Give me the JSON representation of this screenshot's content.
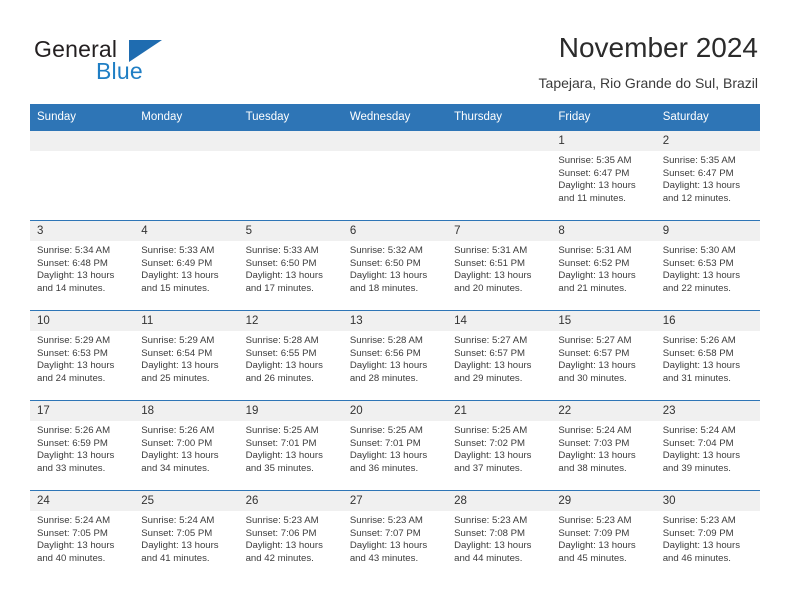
{
  "logo": {
    "word_one": "General",
    "word_two": "Blue",
    "triangle_color": "#1f6cb0",
    "blue_text_color": "#1f7ec4"
  },
  "header": {
    "title": "November 2024",
    "subtitle": "Tapejara, Rio Grande do Sul, Brazil"
  },
  "theme": {
    "header_blue": "#2e75b6",
    "daynum_gray": "#f0f0f0",
    "text": "#333333"
  },
  "calendar": {
    "weekday_headers": [
      "Sunday",
      "Monday",
      "Tuesday",
      "Wednesday",
      "Thursday",
      "Friday",
      "Saturday"
    ],
    "weeks": [
      [
        {
          "day": "",
          "empty": true
        },
        {
          "day": "",
          "empty": true
        },
        {
          "day": "",
          "empty": true
        },
        {
          "day": "",
          "empty": true
        },
        {
          "day": "",
          "empty": true
        },
        {
          "day": "1",
          "sunrise": "Sunrise: 5:35 AM",
          "sunset": "Sunset: 6:47 PM",
          "daylight": "Daylight: 13 hours and 11 minutes."
        },
        {
          "day": "2",
          "sunrise": "Sunrise: 5:35 AM",
          "sunset": "Sunset: 6:47 PM",
          "daylight": "Daylight: 13 hours and 12 minutes."
        }
      ],
      [
        {
          "day": "3",
          "sunrise": "Sunrise: 5:34 AM",
          "sunset": "Sunset: 6:48 PM",
          "daylight": "Daylight: 13 hours and 14 minutes."
        },
        {
          "day": "4",
          "sunrise": "Sunrise: 5:33 AM",
          "sunset": "Sunset: 6:49 PM",
          "daylight": "Daylight: 13 hours and 15 minutes."
        },
        {
          "day": "5",
          "sunrise": "Sunrise: 5:33 AM",
          "sunset": "Sunset: 6:50 PM",
          "daylight": "Daylight: 13 hours and 17 minutes."
        },
        {
          "day": "6",
          "sunrise": "Sunrise: 5:32 AM",
          "sunset": "Sunset: 6:50 PM",
          "daylight": "Daylight: 13 hours and 18 minutes."
        },
        {
          "day": "7",
          "sunrise": "Sunrise: 5:31 AM",
          "sunset": "Sunset: 6:51 PM",
          "daylight": "Daylight: 13 hours and 20 minutes."
        },
        {
          "day": "8",
          "sunrise": "Sunrise: 5:31 AM",
          "sunset": "Sunset: 6:52 PM",
          "daylight": "Daylight: 13 hours and 21 minutes."
        },
        {
          "day": "9",
          "sunrise": "Sunrise: 5:30 AM",
          "sunset": "Sunset: 6:53 PM",
          "daylight": "Daylight: 13 hours and 22 minutes."
        }
      ],
      [
        {
          "day": "10",
          "sunrise": "Sunrise: 5:29 AM",
          "sunset": "Sunset: 6:53 PM",
          "daylight": "Daylight: 13 hours and 24 minutes."
        },
        {
          "day": "11",
          "sunrise": "Sunrise: 5:29 AM",
          "sunset": "Sunset: 6:54 PM",
          "daylight": "Daylight: 13 hours and 25 minutes."
        },
        {
          "day": "12",
          "sunrise": "Sunrise: 5:28 AM",
          "sunset": "Sunset: 6:55 PM",
          "daylight": "Daylight: 13 hours and 26 minutes."
        },
        {
          "day": "13",
          "sunrise": "Sunrise: 5:28 AM",
          "sunset": "Sunset: 6:56 PM",
          "daylight": "Daylight: 13 hours and 28 minutes."
        },
        {
          "day": "14",
          "sunrise": "Sunrise: 5:27 AM",
          "sunset": "Sunset: 6:57 PM",
          "daylight": "Daylight: 13 hours and 29 minutes."
        },
        {
          "day": "15",
          "sunrise": "Sunrise: 5:27 AM",
          "sunset": "Sunset: 6:57 PM",
          "daylight": "Daylight: 13 hours and 30 minutes."
        },
        {
          "day": "16",
          "sunrise": "Sunrise: 5:26 AM",
          "sunset": "Sunset: 6:58 PM",
          "daylight": "Daylight: 13 hours and 31 minutes."
        }
      ],
      [
        {
          "day": "17",
          "sunrise": "Sunrise: 5:26 AM",
          "sunset": "Sunset: 6:59 PM",
          "daylight": "Daylight: 13 hours and 33 minutes."
        },
        {
          "day": "18",
          "sunrise": "Sunrise: 5:26 AM",
          "sunset": "Sunset: 7:00 PM",
          "daylight": "Daylight: 13 hours and 34 minutes."
        },
        {
          "day": "19",
          "sunrise": "Sunrise: 5:25 AM",
          "sunset": "Sunset: 7:01 PM",
          "daylight": "Daylight: 13 hours and 35 minutes."
        },
        {
          "day": "20",
          "sunrise": "Sunrise: 5:25 AM",
          "sunset": "Sunset: 7:01 PM",
          "daylight": "Daylight: 13 hours and 36 minutes."
        },
        {
          "day": "21",
          "sunrise": "Sunrise: 5:25 AM",
          "sunset": "Sunset: 7:02 PM",
          "daylight": "Daylight: 13 hours and 37 minutes."
        },
        {
          "day": "22",
          "sunrise": "Sunrise: 5:24 AM",
          "sunset": "Sunset: 7:03 PM",
          "daylight": "Daylight: 13 hours and 38 minutes."
        },
        {
          "day": "23",
          "sunrise": "Sunrise: 5:24 AM",
          "sunset": "Sunset: 7:04 PM",
          "daylight": "Daylight: 13 hours and 39 minutes."
        }
      ],
      [
        {
          "day": "24",
          "sunrise": "Sunrise: 5:24 AM",
          "sunset": "Sunset: 7:05 PM",
          "daylight": "Daylight: 13 hours and 40 minutes."
        },
        {
          "day": "25",
          "sunrise": "Sunrise: 5:24 AM",
          "sunset": "Sunset: 7:05 PM",
          "daylight": "Daylight: 13 hours and 41 minutes."
        },
        {
          "day": "26",
          "sunrise": "Sunrise: 5:23 AM",
          "sunset": "Sunset: 7:06 PM",
          "daylight": "Daylight: 13 hours and 42 minutes."
        },
        {
          "day": "27",
          "sunrise": "Sunrise: 5:23 AM",
          "sunset": "Sunset: 7:07 PM",
          "daylight": "Daylight: 13 hours and 43 minutes."
        },
        {
          "day": "28",
          "sunrise": "Sunrise: 5:23 AM",
          "sunset": "Sunset: 7:08 PM",
          "daylight": "Daylight: 13 hours and 44 minutes."
        },
        {
          "day": "29",
          "sunrise": "Sunrise: 5:23 AM",
          "sunset": "Sunset: 7:09 PM",
          "daylight": "Daylight: 13 hours and 45 minutes."
        },
        {
          "day": "30",
          "sunrise": "Sunrise: 5:23 AM",
          "sunset": "Sunset: 7:09 PM",
          "daylight": "Daylight: 13 hours and 46 minutes."
        }
      ]
    ]
  }
}
